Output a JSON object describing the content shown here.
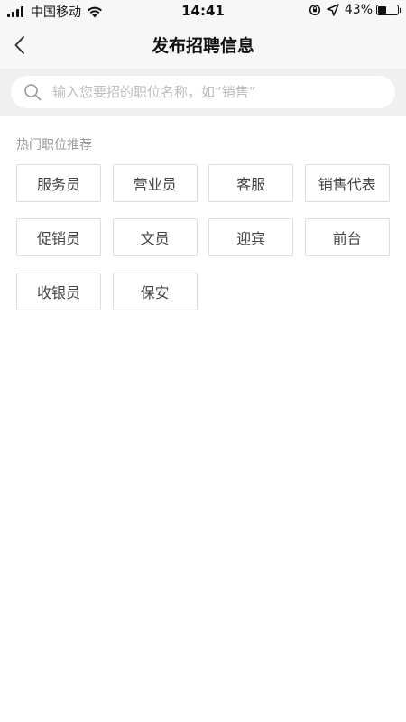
{
  "status_bar": {
    "carrier": "中国移动",
    "time": "14:41",
    "battery_percent": "43%",
    "battery_level": 0.43,
    "icons": [
      "signal-icon",
      "wifi-icon",
      "orientation-lock-icon",
      "location-icon",
      "battery-icon"
    ]
  },
  "nav": {
    "title": "发布招聘信息",
    "back_icon": "chevron-left-icon"
  },
  "search": {
    "placeholder": "输入您要招的职位名称，如“销售”",
    "value": "",
    "icon": "search-icon"
  },
  "hot_positions": {
    "title": "热门职位推荐",
    "items": [
      "服务员",
      "营业员",
      "客服",
      "销售代表",
      "促销员",
      "文员",
      "迎宾",
      "前台",
      "收银员",
      "保安"
    ]
  },
  "colors": {
    "header_bg": "#f7f7f7",
    "search_bg": "#f0f0f0",
    "tag_border": "#dedede",
    "muted_text": "#999999"
  }
}
